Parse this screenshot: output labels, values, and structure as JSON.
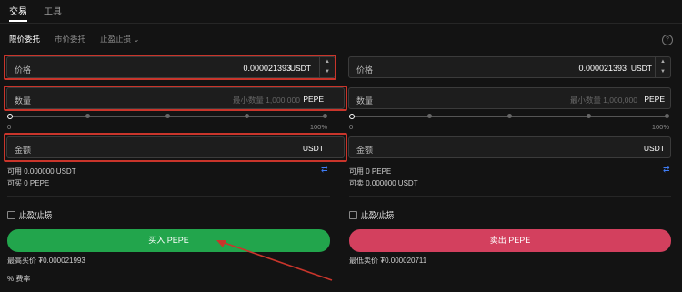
{
  "tabs": [
    "交易",
    "工具"
  ],
  "order_tabs": [
    "限价委托",
    "市价委托",
    "止盈止损"
  ],
  "info_icon": "?",
  "buy": {
    "price_label": "价格",
    "price_value": "0.000021393",
    "price_unit": "USDT",
    "qty_label": "数量",
    "qty_placeholder": "最小数量 1,000,000",
    "qty_unit": "PEPE",
    "amount_label": "金额",
    "amount_unit": "USDT",
    "pct_min": "0",
    "pct_max": "100%",
    "available": "可用 0.000000 USDT",
    "can_buy": "可买 0 PEPE",
    "tpsl": "止盈/止损",
    "button": "买入 PEPE",
    "best": "最高买价 ₮0.000021993",
    "fee": "% 费率"
  },
  "sell": {
    "price_label": "价格",
    "price_value": "0.000021393",
    "price_unit": "USDT",
    "qty_label": "数量",
    "qty_placeholder": "最小数量 1,000,000",
    "qty_unit": "PEPE",
    "amount_label": "金额",
    "amount_unit": "USDT",
    "pct_min": "0",
    "pct_max": "100%",
    "available": "可用 0 PEPE",
    "can_sell": "可卖 0.000000 USDT",
    "tpsl": "止盈/止损",
    "button": "卖出 PEPE",
    "best": "最低卖价 ₮0.000020711"
  },
  "colors": {
    "buy": "#22a54c",
    "sell": "#d3405e",
    "highlight": "#c9352b"
  }
}
